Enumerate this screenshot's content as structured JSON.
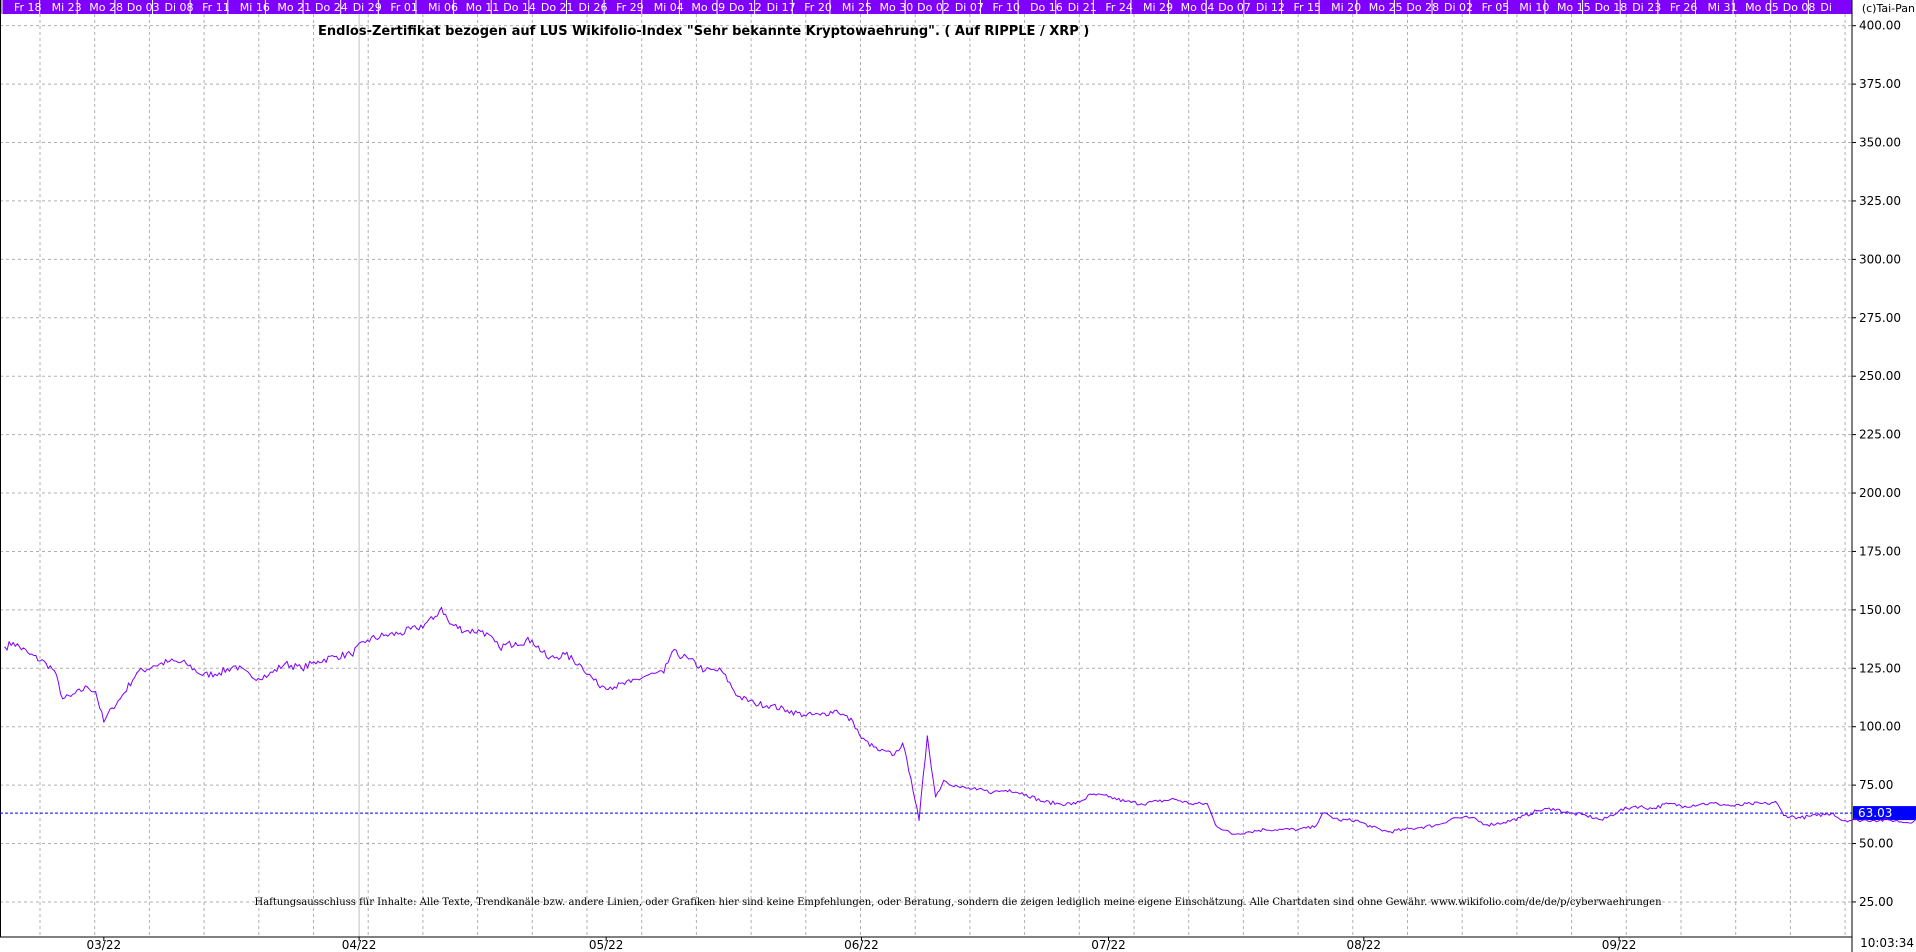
{
  "copyright": "(c)Tai-Pan",
  "timestamp": "10:03:34",
  "date_bar": {
    "labels": [
      "Fr 18",
      "Mi 23",
      "Mo 28",
      "Do 03",
      "Di 08",
      "Fr 11",
      "Mi 16",
      "Mo 21",
      "Do 24",
      "Di 29",
      "Fr 01",
      "Mi 06",
      "Mo 11",
      "Do 14",
      "Do 21",
      "Di 26",
      "Fr 29",
      "Mi 04",
      "Mo 09",
      "Do 12",
      "Di 17",
      "Fr 20",
      "Mi 25",
      "Mo 30",
      "Do 02",
      "Di 07",
      "Fr 10",
      "Do 16",
      "Di 21",
      "Fr 24",
      "Mi 29",
      "Mo 04",
      "Do 07",
      "Di 12",
      "Fr 15",
      "Mi 20",
      "Mo 25",
      "Do 28",
      "Di 02",
      "Fr 05",
      "Mi 10",
      "Mo 15",
      "Do 18",
      "Di 23",
      "Fr 26",
      "Mi 31",
      "Mo 05",
      "Do 08",
      "Di"
    ],
    "bg": "#8000ff",
    "text_color": "#ffffff"
  },
  "disclaimer": "Haftungsausschluss für Inhalte: Alle Texte, Trendkanäle bzw. andere Linien, oder Grafiken hier sind keine Empfehlungen, oder Beratung, sondern die zeigen lediglich meine eigene Einschätzung. Alle Chartdaten sind ohne Gewähr. www.wikifolio.com/de/de/p/cyberwaehrungen",
  "colors": {
    "line": "#8000ff",
    "current_label_bg": "#0000ff",
    "grid": "#b0b0b0"
  },
  "chart_data": {
    "type": "line",
    "title": "Endlos-Zertifikat bezogen auf LUS Wikifolio-Index \"Sehr bekannte Kryptowaehrung\". ( Auf RIPPLE / XRP )",
    "xlabel": "",
    "ylabel": "",
    "ylim": [
      10,
      405
    ],
    "yticks": [
      25,
      50,
      75,
      100,
      125,
      150,
      175,
      200,
      225,
      250,
      275,
      300,
      325,
      350,
      375,
      400
    ],
    "ytick_labels": [
      "25.00",
      "50.00",
      "75.00",
      "100.00",
      "125.00",
      "150.00",
      "175.00",
      "200.00",
      "225.00",
      "250.00",
      "275.00",
      "300.00",
      "325.00",
      "350.00",
      "375.00",
      "400.00"
    ],
    "xlim": [
      "2022-02-17",
      "2022-09-22"
    ],
    "xticks": [
      "2022-03-01",
      "2022-04-01",
      "2022-05-01",
      "2022-06-01",
      "2022-07-01",
      "2022-08-01",
      "2022-09-01"
    ],
    "xtick_labels": [
      "03/22",
      "04/22",
      "05/22",
      "06/22",
      "07/22",
      "08/22",
      "09/22"
    ],
    "current_value": 63.03,
    "current_label": "63.03",
    "grid": true,
    "series": [
      {
        "values": [
          [
            "2022-02-17",
            134
          ],
          [
            "2022-02-18",
            136
          ],
          [
            "2022-02-20",
            131
          ],
          [
            "2022-02-22",
            127
          ],
          [
            "2022-02-23",
            124
          ],
          [
            "2022-02-24",
            112
          ],
          [
            "2022-02-25",
            113
          ],
          [
            "2022-02-27",
            117
          ],
          [
            "2022-02-28",
            115
          ],
          [
            "2022-03-01",
            102
          ],
          [
            "2022-03-02",
            108
          ],
          [
            "2022-03-03",
            112
          ],
          [
            "2022-03-05",
            123
          ],
          [
            "2022-03-07",
            126
          ],
          [
            "2022-03-09",
            128
          ],
          [
            "2022-03-11",
            127
          ],
          [
            "2022-03-13",
            122
          ],
          [
            "2022-03-15",
            123
          ],
          [
            "2022-03-17",
            126
          ],
          [
            "2022-03-19",
            121
          ],
          [
            "2022-03-21",
            122
          ],
          [
            "2022-03-23",
            127
          ],
          [
            "2022-03-25",
            125
          ],
          [
            "2022-03-27",
            128
          ],
          [
            "2022-03-29",
            130
          ],
          [
            "2022-03-31",
            131
          ],
          [
            "2022-04-02",
            137
          ],
          [
            "2022-04-04",
            139
          ],
          [
            "2022-04-06",
            140
          ],
          [
            "2022-04-08",
            142
          ],
          [
            "2022-04-10",
            146
          ],
          [
            "2022-04-11",
            151
          ],
          [
            "2022-04-12",
            144
          ],
          [
            "2022-04-14",
            141
          ],
          [
            "2022-04-16",
            141
          ],
          [
            "2022-04-18",
            134
          ],
          [
            "2022-04-20",
            136
          ],
          [
            "2022-04-22",
            137
          ],
          [
            "2022-04-24",
            129
          ],
          [
            "2022-04-26",
            131
          ],
          [
            "2022-04-28",
            126
          ],
          [
            "2022-04-30",
            118
          ],
          [
            "2022-05-02",
            117
          ],
          [
            "2022-05-04",
            119
          ],
          [
            "2022-05-06",
            122
          ],
          [
            "2022-05-08",
            123
          ],
          [
            "2022-05-09",
            132
          ],
          [
            "2022-05-11",
            129
          ],
          [
            "2022-05-13",
            124
          ],
          [
            "2022-05-15",
            124
          ],
          [
            "2022-05-17",
            113
          ],
          [
            "2022-05-19",
            110
          ],
          [
            "2022-05-21",
            109
          ],
          [
            "2022-05-23",
            107
          ],
          [
            "2022-05-25",
            105
          ],
          [
            "2022-05-27",
            105
          ],
          [
            "2022-05-29",
            107
          ],
          [
            "2022-05-31",
            102
          ],
          [
            "2022-06-01",
            95
          ],
          [
            "2022-06-03",
            90
          ],
          [
            "2022-06-05",
            88
          ],
          [
            "2022-06-06",
            93
          ],
          [
            "2022-06-07",
            78
          ],
          [
            "2022-06-08",
            60
          ],
          [
            "2022-06-09",
            96
          ],
          [
            "2022-06-10",
            70
          ],
          [
            "2022-06-11",
            77
          ],
          [
            "2022-06-13",
            74
          ],
          [
            "2022-06-15",
            73
          ],
          [
            "2022-06-17",
            72
          ],
          [
            "2022-06-19",
            73
          ],
          [
            "2022-06-21",
            71
          ],
          [
            "2022-06-23",
            68
          ],
          [
            "2022-06-25",
            67
          ],
          [
            "2022-06-27",
            67
          ],
          [
            "2022-06-29",
            71
          ],
          [
            "2022-07-01",
            70
          ],
          [
            "2022-07-03",
            68
          ],
          [
            "2022-07-05",
            67
          ],
          [
            "2022-07-07",
            68
          ],
          [
            "2022-07-09",
            69
          ],
          [
            "2022-07-11",
            67
          ],
          [
            "2022-07-13",
            67
          ],
          [
            "2022-07-14",
            58
          ],
          [
            "2022-07-16",
            54
          ],
          [
            "2022-07-18",
            55
          ],
          [
            "2022-07-20",
            56
          ],
          [
            "2022-07-22",
            56
          ],
          [
            "2022-07-24",
            56
          ],
          [
            "2022-07-26",
            57
          ],
          [
            "2022-07-27",
            63
          ],
          [
            "2022-07-29",
            60
          ],
          [
            "2022-07-31",
            60
          ],
          [
            "2022-08-02",
            57
          ],
          [
            "2022-08-04",
            55
          ],
          [
            "2022-08-06",
            56
          ],
          [
            "2022-08-08",
            57
          ],
          [
            "2022-08-10",
            58
          ],
          [
            "2022-08-12",
            61
          ],
          [
            "2022-08-14",
            61
          ],
          [
            "2022-08-16",
            58
          ],
          [
            "2022-08-18",
            59
          ],
          [
            "2022-08-20",
            61
          ],
          [
            "2022-08-22",
            64
          ],
          [
            "2022-08-24",
            65
          ],
          [
            "2022-08-26",
            63
          ],
          [
            "2022-08-28",
            62
          ],
          [
            "2022-08-30",
            60
          ],
          [
            "2022-09-01",
            64
          ],
          [
            "2022-09-03",
            66
          ],
          [
            "2022-09-05",
            65
          ],
          [
            "2022-09-07",
            67
          ],
          [
            "2022-09-09",
            66
          ],
          [
            "2022-09-11",
            67
          ],
          [
            "2022-09-13",
            67
          ],
          [
            "2022-09-15",
            66
          ],
          [
            "2022-09-17",
            67
          ],
          [
            "2022-09-19",
            67
          ],
          [
            "2022-09-20",
            68
          ],
          [
            "2022-09-21",
            62
          ],
          [
            "2022-09-23",
            61
          ],
          [
            "2022-09-25",
            62
          ],
          [
            "2022-09-27",
            63
          ],
          [
            "2022-09-28",
            60
          ],
          [
            "2022-09-30",
            60
          ],
          [
            "2022-10-02",
            60
          ],
          [
            "2022-10-04",
            60
          ],
          [
            "2022-10-06",
            59
          ],
          [
            "2022-10-08",
            61
          ],
          [
            "2022-10-10",
            63
          ]
        ]
      }
    ]
  }
}
